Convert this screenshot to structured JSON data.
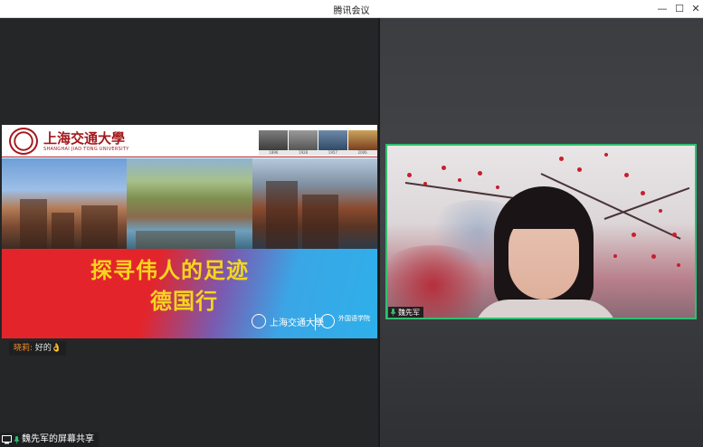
{
  "window": {
    "title": "腾讯会议",
    "minimize_glyph": "—",
    "maximize_glyph": "☐",
    "close_glyph": "✕"
  },
  "slide": {
    "university_name": "上海交通大學",
    "university_en": "SHANGHAI JIAO TONG UNIVERSITY",
    "strip_years": [
      "1896",
      "1928",
      "1957",
      "2006"
    ],
    "title_line1": "探寻伟人的足迹",
    "title_line2": "德国行",
    "logo1_text": "上海交通大學",
    "logo2_text": "外国语学院"
  },
  "chat": {
    "sender": "晓莉:",
    "message": "好的👌"
  },
  "share": {
    "label": "魏先军的屏幕共享",
    "icon": "screen-share-icon"
  },
  "participant": {
    "name": "魏先军",
    "icon": "microphone-icon"
  },
  "colors": {
    "active_speaker_border": "#2fbf71",
    "chat_name": "#f08a24",
    "slide_title": "#f7d51c",
    "mic_green": "#2fbf71"
  }
}
